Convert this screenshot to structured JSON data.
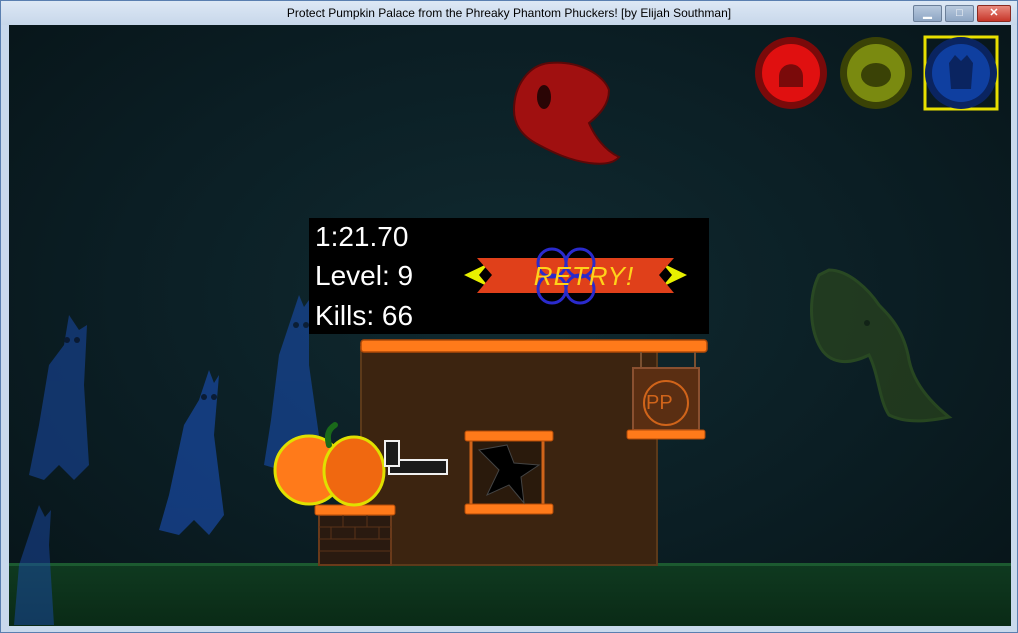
{
  "window": {
    "title": "Protect Pumpkin Palace from the Phreaky Phantom Phuckers! [by Elijah Southman]",
    "minimize_glyph": "▁",
    "maximize_glyph": "□",
    "close_glyph": "✕"
  },
  "hud": {
    "timer": "1:21.70",
    "level": "Level: 9",
    "kills": "Kills: 66",
    "retry_label": "RETRY!"
  },
  "sign": {
    "label": "PP"
  },
  "weapons": [
    {
      "name": "red-ghost-weapon",
      "color": "#e01010",
      "selected": false
    },
    {
      "name": "green-ghost-weapon",
      "color": "#7a8a10",
      "selected": false
    },
    {
      "name": "blue-ghost-weapon",
      "color": "#0f3fa0",
      "selected": true
    }
  ],
  "colors": {
    "accent_orange": "#ff7a1a",
    "banner_red": "#e0401a",
    "banner_yellow": "#e8f000",
    "retry_text": "#ffd21a"
  }
}
